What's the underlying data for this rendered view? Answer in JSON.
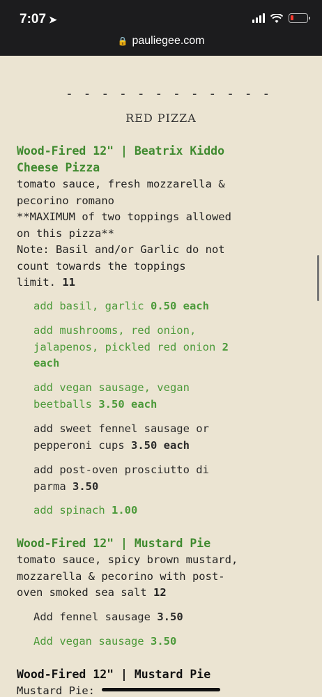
{
  "status": {
    "time": "7:07"
  },
  "browser": {
    "url": "pauliegee.com"
  },
  "menu": {
    "divider": "- - - - - - - - - - - -",
    "section_title": "RED PIZZA",
    "item1": {
      "title_line1": "Wood-Fired 12\" | Beatrix Kiddo",
      "title_line2": "Cheese Pizza",
      "desc_lines": [
        "tomato sauce, fresh mozzarella &",
        "pecorino romano",
        "**MAXIMUM of two toppings allowed",
        "on this pizza**",
        "Note: Basil and/or Garlic do not",
        "count towards the toppings",
        "limit."
      ],
      "price": "11",
      "addons": [
        {
          "text": "add basil, garlic",
          "price": "0.50 each"
        },
        {
          "text": "add mushrooms, red onion,",
          "text2": "jalapenos, pickled red onion",
          "price": "2",
          "price2": "each"
        },
        {
          "text": "add vegan sausage, vegan",
          "text2": "beetballs",
          "price": "3.50 each"
        },
        {
          "text": "add sweet fennel sausage or",
          "text2": "pepperoni cups",
          "price": "3.50 each"
        },
        {
          "text": "add post-oven prosciutto di",
          "text2": "parma",
          "price": "3.50"
        },
        {
          "text": "add spinach",
          "price": "1.00"
        }
      ]
    },
    "item2": {
      "title": "Wood-Fired 12\" | Mustard Pie",
      "desc_lines": [
        "tomato sauce, spicy brown mustard,",
        "mozzarella & pecorino with post-",
        "oven smoked sea salt"
      ],
      "price": "12",
      "addons": [
        {
          "text": "Add fennel sausage",
          "price": "3.50"
        },
        {
          "text": "Add vegan sausage",
          "price": "3.50"
        }
      ]
    },
    "item3": {
      "title": "Wood-Fired 12\" | Mustard Pie",
      "desc_partial": "Mustard Pie:"
    }
  },
  "colors": {
    "green": "#3f8a2f",
    "paper": "#ebe4d2",
    "topbar": "#1c1c1e"
  }
}
